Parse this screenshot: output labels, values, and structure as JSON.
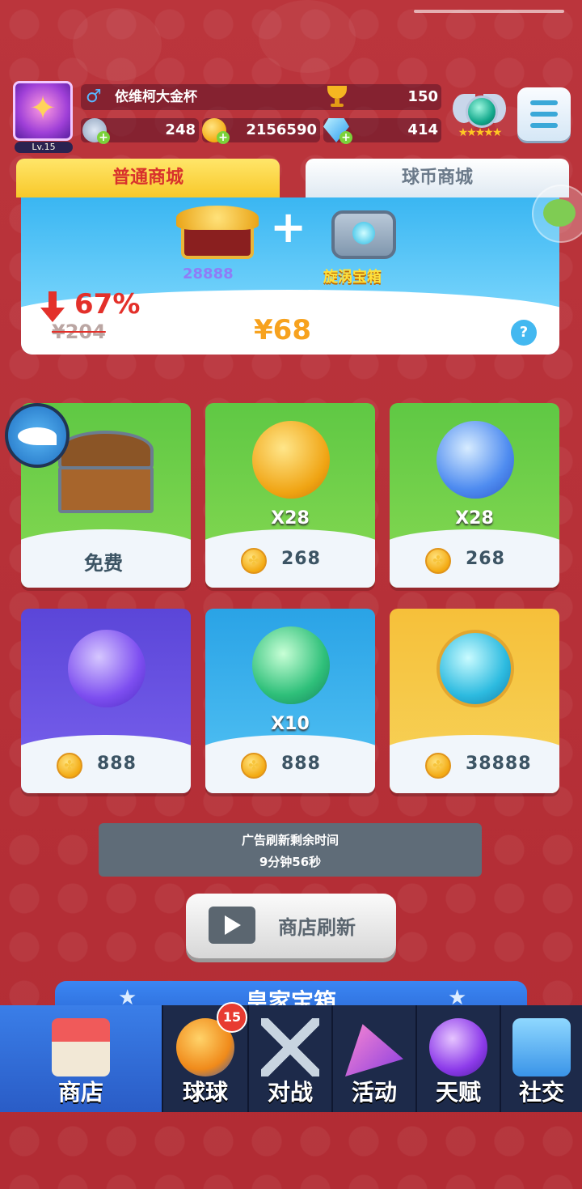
{
  "player": {
    "name": "依维柯大金杯",
    "level_label": "Lv.15",
    "gender_symbol": "♂",
    "trophies": "150"
  },
  "resources": {
    "energy": "248",
    "coins": "2156590",
    "diamonds": "414"
  },
  "tabs": [
    {
      "label": "普通商城",
      "active": true
    },
    {
      "label": "球币商城",
      "active": false
    }
  ],
  "banner": {
    "item1_label": "28888",
    "item2_label": "旋涡宝箱",
    "discount": "67%",
    "old_price": "¥204",
    "new_price": "¥68",
    "help_symbol": "?"
  },
  "shop_items": [
    {
      "icon": "treasure-chest-icon",
      "qty": "",
      "price": "免费",
      "theme": "green"
    },
    {
      "icon": "lightning-orb-icon",
      "qty": "X28",
      "price": "268",
      "theme": "green"
    },
    {
      "icon": "snowflake-orb-icon",
      "qty": "X28",
      "price": "268",
      "theme": "green"
    },
    {
      "icon": "swap-orb-icon",
      "qty": "",
      "price": "888",
      "theme": "purple"
    },
    {
      "icon": "sp-orb-icon",
      "qty": "X10",
      "price": "888",
      "theme": "blue"
    },
    {
      "icon": "crystal-orb-icon",
      "qty": "",
      "price": "38888",
      "theme": "gold"
    }
  ],
  "refresh": {
    "timer_title": "广告刷新剩余时间",
    "timer_value": "9分钟56秒",
    "button_label": "商店刷新"
  },
  "royal_chest": {
    "label": "皇家宝箱"
  },
  "nav": [
    {
      "label": "商店",
      "active": true
    },
    {
      "label": "球球",
      "badge": "15"
    },
    {
      "label": "对战"
    },
    {
      "label": "活动"
    },
    {
      "label": "天赋"
    },
    {
      "label": "社交"
    }
  ],
  "colors": {
    "background": "#b8323a",
    "tab_active": "#f8c82a",
    "nav_active": "#2a5cc6",
    "price_accent": "#f7a21e"
  }
}
